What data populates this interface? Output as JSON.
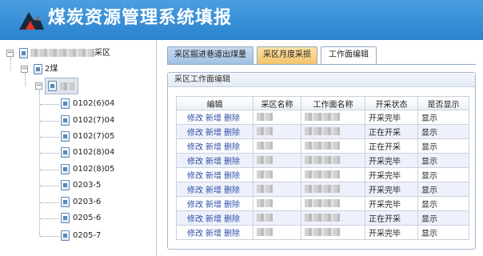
{
  "app": {
    "title": "煤炭资源管理系统填报"
  },
  "tree": {
    "root_suffix": "采区",
    "seam": "2煤",
    "faces": [
      "0102(6)04",
      "0102(7)04",
      "0102(7)05",
      "0102(8)04",
      "0102(8)05",
      "0203-5",
      "0203-6",
      "0205-6",
      "0205-7"
    ]
  },
  "tabs": [
    {
      "label": "采区掘进巷道出煤量"
    },
    {
      "label": "采区月度采损"
    },
    {
      "label": "工作面编辑"
    }
  ],
  "panel": {
    "title": "采区工作面编辑"
  },
  "table": {
    "headers": [
      "编辑",
      "采区名称",
      "工作面名称",
      "开采状态",
      "是否显示"
    ],
    "actions": [
      "修改",
      "新增",
      "删除"
    ],
    "rows": [
      {
        "status": "开采完毕",
        "show": "显示"
      },
      {
        "status": "正在开采",
        "show": "显示"
      },
      {
        "status": "正在开采",
        "show": "显示"
      },
      {
        "status": "开采完毕",
        "show": "显示"
      },
      {
        "status": "开采完毕",
        "show": "显示"
      },
      {
        "status": "开采完毕",
        "show": "显示"
      },
      {
        "status": "开采完毕",
        "show": "显示"
      },
      {
        "status": "正在开采",
        "show": "显示"
      },
      {
        "status": "开采完毕",
        "show": "显示"
      }
    ]
  },
  "colors": {
    "header_bg": "#2a82cf",
    "link": "#2d4fa8",
    "tab_active": "#f5c46a",
    "row_alt": "#eef1fb"
  }
}
